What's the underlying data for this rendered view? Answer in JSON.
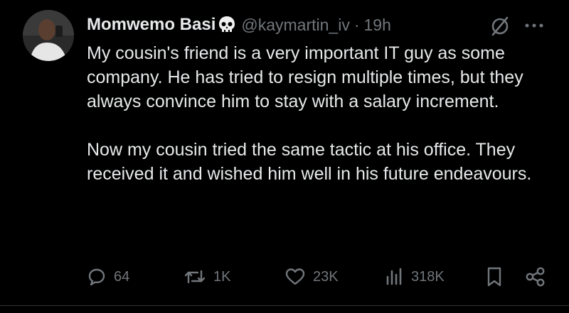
{
  "tweet": {
    "author": {
      "display_name": "Momwemo Basi",
      "badge_icon": "skull-icon",
      "handle": "@kaymartin_iv",
      "separator": "·",
      "time": "19h"
    },
    "paragraphs": [
      "My cousin's friend is a very important IT guy as some company. He has tried to resign multiple times, but they always convince him to stay with a salary increment.",
      "Now my cousin tried the same tactic at his office. They received it and wished him well in his future endeavours."
    ],
    "header_icons": [
      "grok-icon",
      "more-icon"
    ],
    "actions": {
      "replies": "64",
      "reposts": "1K",
      "likes": "23K",
      "views": "318K"
    },
    "action_icons": [
      "reply-icon",
      "repost-icon",
      "like-icon",
      "views-icon",
      "bookmark-icon",
      "share-icon"
    ]
  },
  "colors": {
    "background": "#000000",
    "text_primary": "#e7e9ea",
    "text_secondary": "#71767b"
  }
}
